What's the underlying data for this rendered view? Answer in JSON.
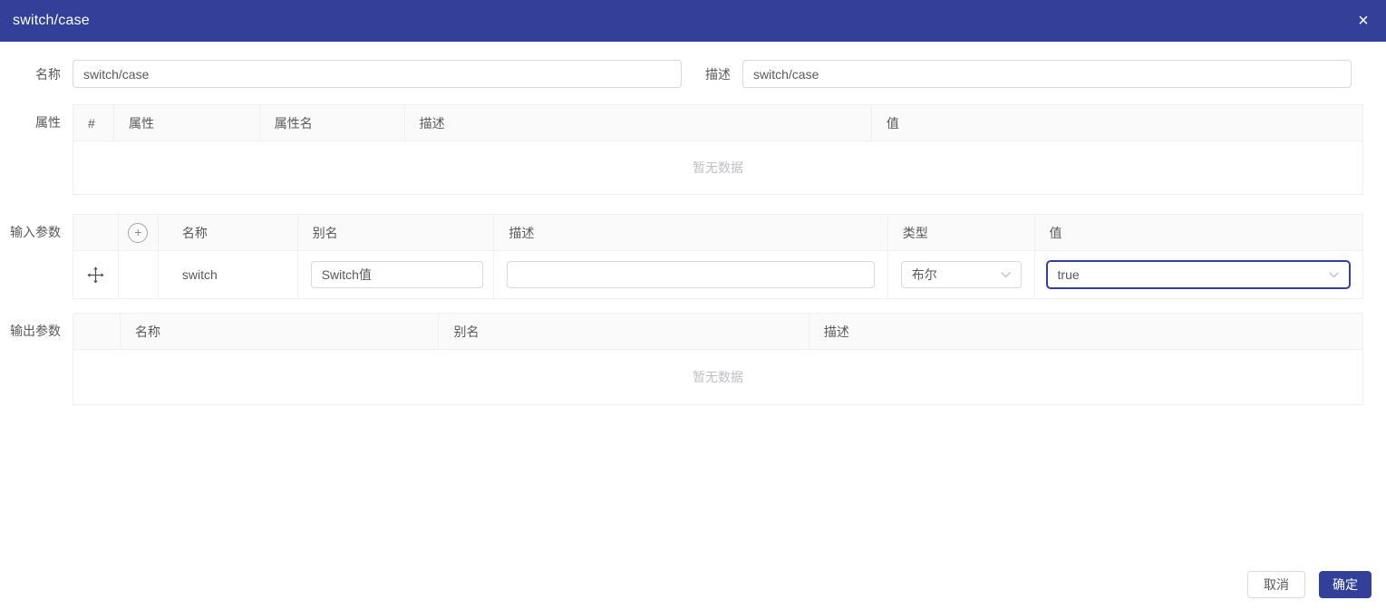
{
  "modal": {
    "title": "switch/case",
    "close_icon": "×"
  },
  "form": {
    "name_label": "名称",
    "name_value": "switch/case",
    "desc_label": "描述",
    "desc_value": "switch/case"
  },
  "sections": {
    "attributes": {
      "label": "属性",
      "columns": [
        "#",
        "属性",
        "属性名",
        "描述",
        "值"
      ],
      "empty_text": "暂无数据"
    },
    "inputs": {
      "label": "输入参数",
      "add_icon": "+",
      "columns": [
        "名称",
        "别名",
        "描述",
        "类型",
        "值"
      ],
      "rows": [
        {
          "name": "switch",
          "alias": "Switch值",
          "desc": "",
          "type": "布尔",
          "value": "true"
        }
      ]
    },
    "outputs": {
      "label": "输出参数",
      "columns": [
        "名称",
        "别名",
        "描述"
      ],
      "empty_text": "暂无数据"
    }
  },
  "footer": {
    "cancel_label": "取消",
    "ok_label": "确定"
  },
  "colors": {
    "primary": "#32409a",
    "border": "#d9d9d9",
    "table_border": "#f0f0f0",
    "empty_text": "#bfbfc6"
  }
}
